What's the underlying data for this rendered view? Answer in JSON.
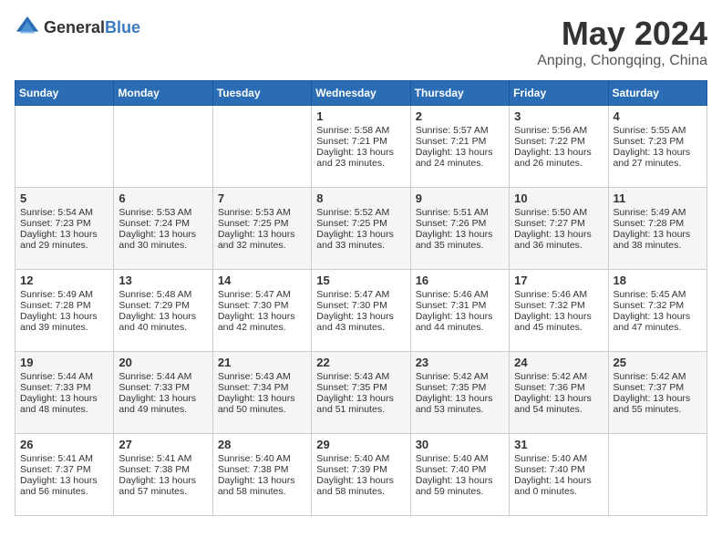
{
  "logo": {
    "text_general": "General",
    "text_blue": "Blue"
  },
  "title": "May 2024",
  "subtitle": "Anping, Chongqing, China",
  "days_of_week": [
    "Sunday",
    "Monday",
    "Tuesday",
    "Wednesday",
    "Thursday",
    "Friday",
    "Saturday"
  ],
  "weeks": [
    [
      null,
      null,
      null,
      {
        "day": 1,
        "sunrise": "5:58 AM",
        "sunset": "7:21 PM",
        "daylight": "13 hours and 23 minutes."
      },
      {
        "day": 2,
        "sunrise": "5:57 AM",
        "sunset": "7:21 PM",
        "daylight": "13 hours and 24 minutes."
      },
      {
        "day": 3,
        "sunrise": "5:56 AM",
        "sunset": "7:22 PM",
        "daylight": "13 hours and 26 minutes."
      },
      {
        "day": 4,
        "sunrise": "5:55 AM",
        "sunset": "7:23 PM",
        "daylight": "13 hours and 27 minutes."
      }
    ],
    [
      {
        "day": 5,
        "sunrise": "5:54 AM",
        "sunset": "7:23 PM",
        "daylight": "13 hours and 29 minutes."
      },
      {
        "day": 6,
        "sunrise": "5:53 AM",
        "sunset": "7:24 PM",
        "daylight": "13 hours and 30 minutes."
      },
      {
        "day": 7,
        "sunrise": "5:53 AM",
        "sunset": "7:25 PM",
        "daylight": "13 hours and 32 minutes."
      },
      {
        "day": 8,
        "sunrise": "5:52 AM",
        "sunset": "7:25 PM",
        "daylight": "13 hours and 33 minutes."
      },
      {
        "day": 9,
        "sunrise": "5:51 AM",
        "sunset": "7:26 PM",
        "daylight": "13 hours and 35 minutes."
      },
      {
        "day": 10,
        "sunrise": "5:50 AM",
        "sunset": "7:27 PM",
        "daylight": "13 hours and 36 minutes."
      },
      {
        "day": 11,
        "sunrise": "5:49 AM",
        "sunset": "7:28 PM",
        "daylight": "13 hours and 38 minutes."
      }
    ],
    [
      {
        "day": 12,
        "sunrise": "5:49 AM",
        "sunset": "7:28 PM",
        "daylight": "13 hours and 39 minutes."
      },
      {
        "day": 13,
        "sunrise": "5:48 AM",
        "sunset": "7:29 PM",
        "daylight": "13 hours and 40 minutes."
      },
      {
        "day": 14,
        "sunrise": "5:47 AM",
        "sunset": "7:30 PM",
        "daylight": "13 hours and 42 minutes."
      },
      {
        "day": 15,
        "sunrise": "5:47 AM",
        "sunset": "7:30 PM",
        "daylight": "13 hours and 43 minutes."
      },
      {
        "day": 16,
        "sunrise": "5:46 AM",
        "sunset": "7:31 PM",
        "daylight": "13 hours and 44 minutes."
      },
      {
        "day": 17,
        "sunrise": "5:46 AM",
        "sunset": "7:32 PM",
        "daylight": "13 hours and 45 minutes."
      },
      {
        "day": 18,
        "sunrise": "5:45 AM",
        "sunset": "7:32 PM",
        "daylight": "13 hours and 47 minutes."
      }
    ],
    [
      {
        "day": 19,
        "sunrise": "5:44 AM",
        "sunset": "7:33 PM",
        "daylight": "13 hours and 48 minutes."
      },
      {
        "day": 20,
        "sunrise": "5:44 AM",
        "sunset": "7:33 PM",
        "daylight": "13 hours and 49 minutes."
      },
      {
        "day": 21,
        "sunrise": "5:43 AM",
        "sunset": "7:34 PM",
        "daylight": "13 hours and 50 minutes."
      },
      {
        "day": 22,
        "sunrise": "5:43 AM",
        "sunset": "7:35 PM",
        "daylight": "13 hours and 51 minutes."
      },
      {
        "day": 23,
        "sunrise": "5:42 AM",
        "sunset": "7:35 PM",
        "daylight": "13 hours and 53 minutes."
      },
      {
        "day": 24,
        "sunrise": "5:42 AM",
        "sunset": "7:36 PM",
        "daylight": "13 hours and 54 minutes."
      },
      {
        "day": 25,
        "sunrise": "5:42 AM",
        "sunset": "7:37 PM",
        "daylight": "13 hours and 55 minutes."
      }
    ],
    [
      {
        "day": 26,
        "sunrise": "5:41 AM",
        "sunset": "7:37 PM",
        "daylight": "13 hours and 56 minutes."
      },
      {
        "day": 27,
        "sunrise": "5:41 AM",
        "sunset": "7:38 PM",
        "daylight": "13 hours and 57 minutes."
      },
      {
        "day": 28,
        "sunrise": "5:40 AM",
        "sunset": "7:38 PM",
        "daylight": "13 hours and 58 minutes."
      },
      {
        "day": 29,
        "sunrise": "5:40 AM",
        "sunset": "7:39 PM",
        "daylight": "13 hours and 58 minutes."
      },
      {
        "day": 30,
        "sunrise": "5:40 AM",
        "sunset": "7:40 PM",
        "daylight": "13 hours and 59 minutes."
      },
      {
        "day": 31,
        "sunrise": "5:40 AM",
        "sunset": "7:40 PM",
        "daylight": "14 hours and 0 minutes."
      },
      null
    ]
  ]
}
